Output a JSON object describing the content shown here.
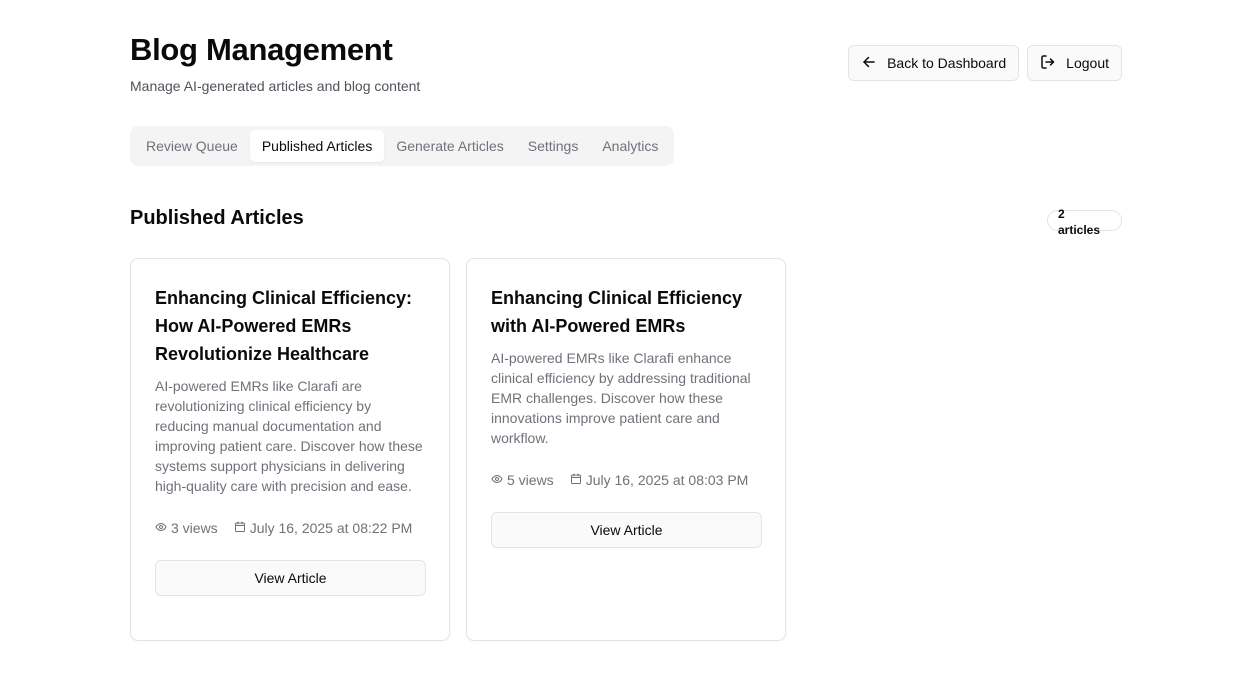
{
  "header": {
    "title": "Blog Management",
    "subtitle": "Manage AI-generated articles and blog content",
    "back_label": "Back to Dashboard",
    "back_icon": "arrow-left-icon",
    "logout_label": "Logout",
    "logout_icon": "logout-icon"
  },
  "tabs": [
    {
      "label": "Review Queue",
      "active": false
    },
    {
      "label": "Published Articles",
      "active": true
    },
    {
      "label": "Generate Articles",
      "active": false
    },
    {
      "label": "Settings",
      "active": false
    },
    {
      "label": "Analytics",
      "active": false
    }
  ],
  "section": {
    "title": "Published Articles",
    "count_label": "2 articles"
  },
  "articles": [
    {
      "title": "Enhancing Clinical Efficiency: How AI-Powered EMRs Revolutionize Healthcare",
      "excerpt": "AI-powered EMRs like Clarafi are revolutionizing clinical efficiency by reducing manual documentation and improving patient care. Discover how these systems support physicians in delivering high-quality care with precision and ease.",
      "views": "3 views",
      "date": "July 16, 2025 at 08:22 PM",
      "button_label": "View Article"
    },
    {
      "title": "Enhancing Clinical Efficiency with AI-Powered EMRs",
      "excerpt": "AI-powered EMRs like Clarafi enhance clinical efficiency by addressing traditional EMR challenges. Discover how these innovations improve patient care and workflow.",
      "views": "5 views",
      "date": "July 16, 2025 at 08:03 PM",
      "button_label": "View Article"
    }
  ],
  "colors": {
    "text": "#0a0a0a",
    "muted": "#71717a",
    "border": "#e4e4e7",
    "tab_bg": "#f4f4f5"
  }
}
